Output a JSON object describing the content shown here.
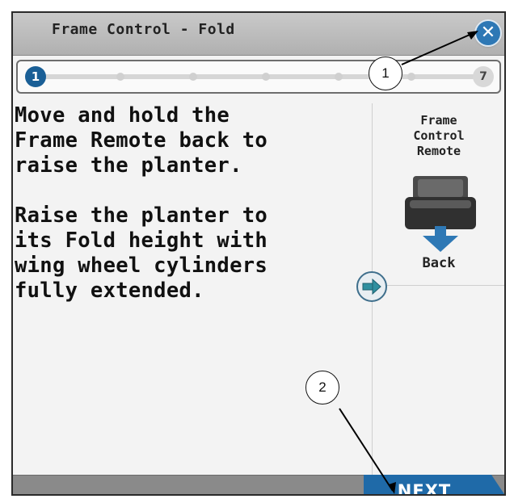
{
  "window": {
    "title": "Frame Control - Fold",
    "close_icon": "close-icon"
  },
  "progress": {
    "current_step": "1",
    "total_steps": "7",
    "fraction_complete": 0.14
  },
  "instructions": {
    "paragraph_1": "Move and hold the\nFrame Remote back to\nraise the planter.",
    "paragraph_2": "Raise the planter to\nits Fold height with\nwing wheel cylinders\nfully extended."
  },
  "side_panel": {
    "remote_title": "Frame\nControl\nRemote",
    "remote_icon": "remote-lever-icon",
    "direction_label": "Back",
    "direction_icon": "arrow-down-icon"
  },
  "scroll_button": {
    "icon": "arrow-right-icon"
  },
  "footer": {
    "next_label": "NEXT"
  },
  "callouts": {
    "c1": "1",
    "c2": "2"
  },
  "colors": {
    "accent_blue": "#2e78b5",
    "step_blue": "#1a5f96",
    "titlebar_gray": "#b8b8b8",
    "footer_gray": "#8a8a8a"
  }
}
